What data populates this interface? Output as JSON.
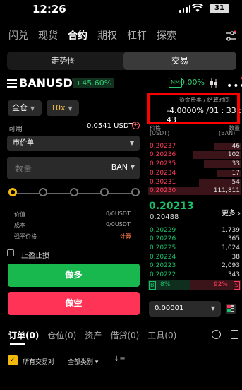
{
  "status_bar": {
    "time": "12:26",
    "battery": "31"
  },
  "top_nav": {
    "items": [
      "闪兑",
      "现货",
      "合约",
      "期权",
      "杠杆",
      "探索"
    ],
    "active_index": 2
  },
  "view_tabs": {
    "chart_label": "走势图",
    "trade_label": "交易"
  },
  "pair": {
    "name": "BANUSDT",
    "change": "+45.60%",
    "nm_badge": "NM",
    "nm_value": "0.00%"
  },
  "funding": {
    "label": "资金费率 / 结算时间",
    "value": "-4.0000% /01 : 33 : 43"
  },
  "order_form": {
    "margin_mode": "全仓",
    "leverage": "10x",
    "available_label": "可用",
    "available_value": "0.0541 USDT",
    "order_type": "市价单",
    "quantity_placeholder": "数量",
    "quantity_unit": "BAN",
    "value_label": "价值",
    "value_value": "0/0USDT",
    "cost_label": "成本",
    "cost_value": "0/0USDT",
    "liq_label": "强平价格",
    "liq_action": "计算",
    "tpsl_label": "止盈止损",
    "buy_label": "做多",
    "sell_label": "做空"
  },
  "orderbook": {
    "price_header": "价格",
    "price_unit": "(USDT)",
    "qty_header": "数量",
    "qty_unit": "(BAN)",
    "asks": [
      {
        "price": "0.20237",
        "qty": "46",
        "depth": 0.3
      },
      {
        "price": "0.20236",
        "qty": "102",
        "depth": 0.55
      },
      {
        "price": "0.20235",
        "qty": "33",
        "depth": 0.4
      },
      {
        "price": "0.20234",
        "qty": "17",
        "depth": 0.25
      },
      {
        "price": "0.20231",
        "qty": "54",
        "depth": 0.45
      },
      {
        "price": "0.20230",
        "qty": "111,811",
        "depth": 1.0
      }
    ],
    "last_price": "0.20213",
    "mark_price": "0.20488",
    "more_label": "更多",
    "bids": [
      {
        "price": "0.20229",
        "qty": "1,739"
      },
      {
        "price": "0.20226",
        "qty": "365"
      },
      {
        "price": "0.20225",
        "qty": "1,024"
      },
      {
        "price": "0.20224",
        "qty": "38"
      },
      {
        "price": "0.20223",
        "qty": "2,093"
      },
      {
        "price": "0.20222",
        "qty": "343"
      }
    ],
    "buy_badge": "B",
    "buy_ratio": "8%",
    "sell_ratio": "92%",
    "sell_badge": "S",
    "precision": "0.00001"
  },
  "bottom_tabs": {
    "items": [
      "订单(0)",
      "仓位(0)",
      "资产",
      "借贷(0)",
      "工具(0)"
    ],
    "active_index": 0
  },
  "filters": {
    "all_pairs": "所有交易对",
    "all_categories": "全部类别"
  }
}
